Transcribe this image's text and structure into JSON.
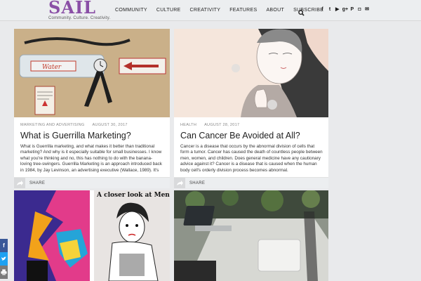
{
  "header": {
    "logo": "SAIL",
    "tagline": "Community. Culture. Creativity.",
    "nav": [
      "COMMUNITY",
      "CULTURE",
      "CREATIVITY",
      "FEATURES",
      "ABOUT",
      "SUBSCRIBE"
    ],
    "social_icons": [
      "facebook-icon",
      "twitter-icon",
      "youtube-icon",
      "google-plus-icon",
      "pinterest-icon",
      "instagram-icon",
      "email-icon"
    ],
    "social_glyphs": [
      "f",
      "t",
      "▶",
      "g+",
      "P",
      "◘",
      "✉"
    ],
    "accent_color": "#8a4fa6"
  },
  "posts": [
    {
      "category": "MARKETING AND ADVERTISING",
      "date": "AUGUST 30, 2017",
      "title": "What is Guerrilla Marketing?",
      "excerpt": "What is Guerrilla marketing, and what makes it better than traditional marketing? And why is it especially suitable for small businesses. I know what you're thinking and no, this has nothing to do with the banana-loving tree-swingers. Guerrilla Marketing is an approach introduced back in 1984, by Jay Levinson, an advertising executive (Wallace, 1989). It's",
      "share_label": "SHARE",
      "image_label": "Water"
    },
    {
      "category": "HEALTH",
      "date": "AUGUST 28, 2017",
      "title": "Can Cancer Be Avoided at All?",
      "excerpt": "Cancer is a disease that occurs by the abnormal division of cells that form a tumor. Cancer has caused the death of countless people between men, women, and children. Does general medicine have any cautionary advice against it? Cancer is a disease that is caused when the human body cell's orderly division process becomes abnormal.",
      "share_label": "SHARE"
    },
    {
      "image_caption": "A closer look at Mental Illness"
    },
    {}
  ],
  "side_share": [
    "facebook-icon",
    "twitter-icon",
    "print-icon"
  ],
  "side_share_colors": [
    "#3b5998",
    "#1da1f2",
    "#7a7a7a"
  ]
}
